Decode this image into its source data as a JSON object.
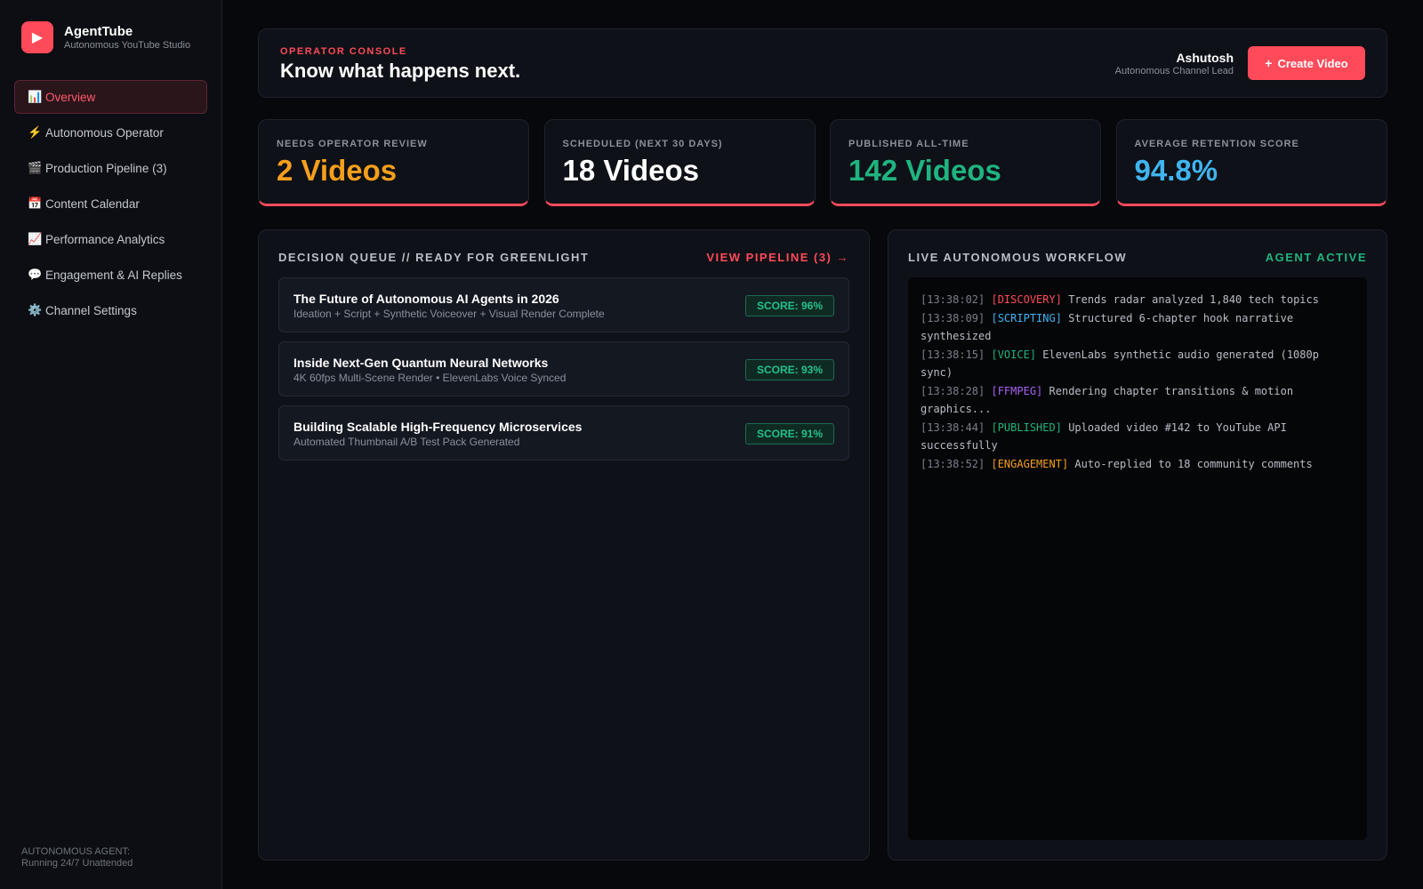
{
  "app": {
    "name": "AgentTube",
    "subtitle": "Autonomous YouTube Studio",
    "logo_icon": "play-icon"
  },
  "sidebar": {
    "items": [
      {
        "icon": "📊",
        "label": "Overview",
        "active": true
      },
      {
        "icon": "⚡",
        "label": "Autonomous Operator",
        "active": false
      },
      {
        "icon": "🎬",
        "label": "Production Pipeline (3)",
        "active": false
      },
      {
        "icon": "📅",
        "label": "Content Calendar",
        "active": false
      },
      {
        "icon": "📈",
        "label": "Performance Analytics",
        "active": false
      },
      {
        "icon": "💬",
        "label": "Engagement & AI Replies",
        "active": false
      },
      {
        "icon": "⚙️",
        "label": "Channel Settings",
        "active": false
      }
    ],
    "agent_status_line1": "AUTONOMOUS AGENT:",
    "agent_status_line2": "Running 24/7 Unattended"
  },
  "header": {
    "eyebrow": "OPERATOR CONSOLE",
    "title": "Know what happens next.",
    "user_name": "Ashutosh",
    "user_role": "Autonomous Channel Lead",
    "create_label": "Create Video",
    "create_icon": "+"
  },
  "stats": [
    {
      "label": "NEEDS OPERATOR REVIEW",
      "value": "2 Videos",
      "color": "#f59f1c"
    },
    {
      "label": "SCHEDULED (NEXT 30 DAYS)",
      "value": "18 Videos",
      "color": "#ffffff"
    },
    {
      "label": "PUBLISHED ALL-TIME",
      "value": "142 Videos",
      "color": "#1fb47f"
    },
    {
      "label": "AVERAGE RETENTION SCORE",
      "value": "94.8%",
      "color": "#3fb4f0"
    }
  ],
  "queue": {
    "title": "DECISION QUEUE // READY FOR GREENLIGHT",
    "action": "VIEW PIPELINE (3) →",
    "items": [
      {
        "title": "The Future of Autonomous AI Agents in 2026",
        "subtitle": "Ideation + Script + Synthetic Voiceover + Visual Render Complete",
        "score": "SCORE: 96%"
      },
      {
        "title": "Inside Next-Gen Quantum Neural Networks",
        "subtitle": "4K 60fps Multi-Scene Render • ElevenLabs Voice Synced",
        "score": "SCORE: 93%"
      },
      {
        "title": "Building Scalable High-Frequency Microservices",
        "subtitle": "Automated Thumbnail A/B Test Pack Generated",
        "score": "SCORE: 91%"
      }
    ]
  },
  "workflow": {
    "title": "LIVE AUTONOMOUS WORKFLOW",
    "status": "AGENT ACTIVE",
    "logs": [
      {
        "time": "[13:38:02]",
        "tag": "[DISCOVERY]",
        "tag_color": "#ff4a5a",
        "text": "Trends radar analyzed 1,840 tech topics"
      },
      {
        "time": "[13:38:09]",
        "tag": "[SCRIPTING]",
        "tag_color": "#3fb4f0",
        "text": "Structured 6-chapter hook narrative synthesized"
      },
      {
        "time": "[13:38:15]",
        "tag": "[VOICE]",
        "tag_color": "#1fb47f",
        "text": "ElevenLabs synthetic audio generated (1080p sync)"
      },
      {
        "time": "[13:38:28]",
        "tag": "[FFMPEG]",
        "tag_color": "#a761f2",
        "text": "Rendering chapter transitions & motion graphics..."
      },
      {
        "time": "[13:38:44]",
        "tag": "[PUBLISHED]",
        "tag_color": "#1fb47f",
        "text": "Uploaded video #142 to YouTube API successfully"
      },
      {
        "time": "[13:38:52]",
        "tag": "[ENGAGEMENT]",
        "tag_color": "#f59f1c",
        "text": "Auto-replied to 18 community comments"
      }
    ]
  },
  "colors": {
    "accent": "#ff4a5a",
    "success": "#1fb47f",
    "background": "#07080b",
    "panel": "#0e1117"
  }
}
